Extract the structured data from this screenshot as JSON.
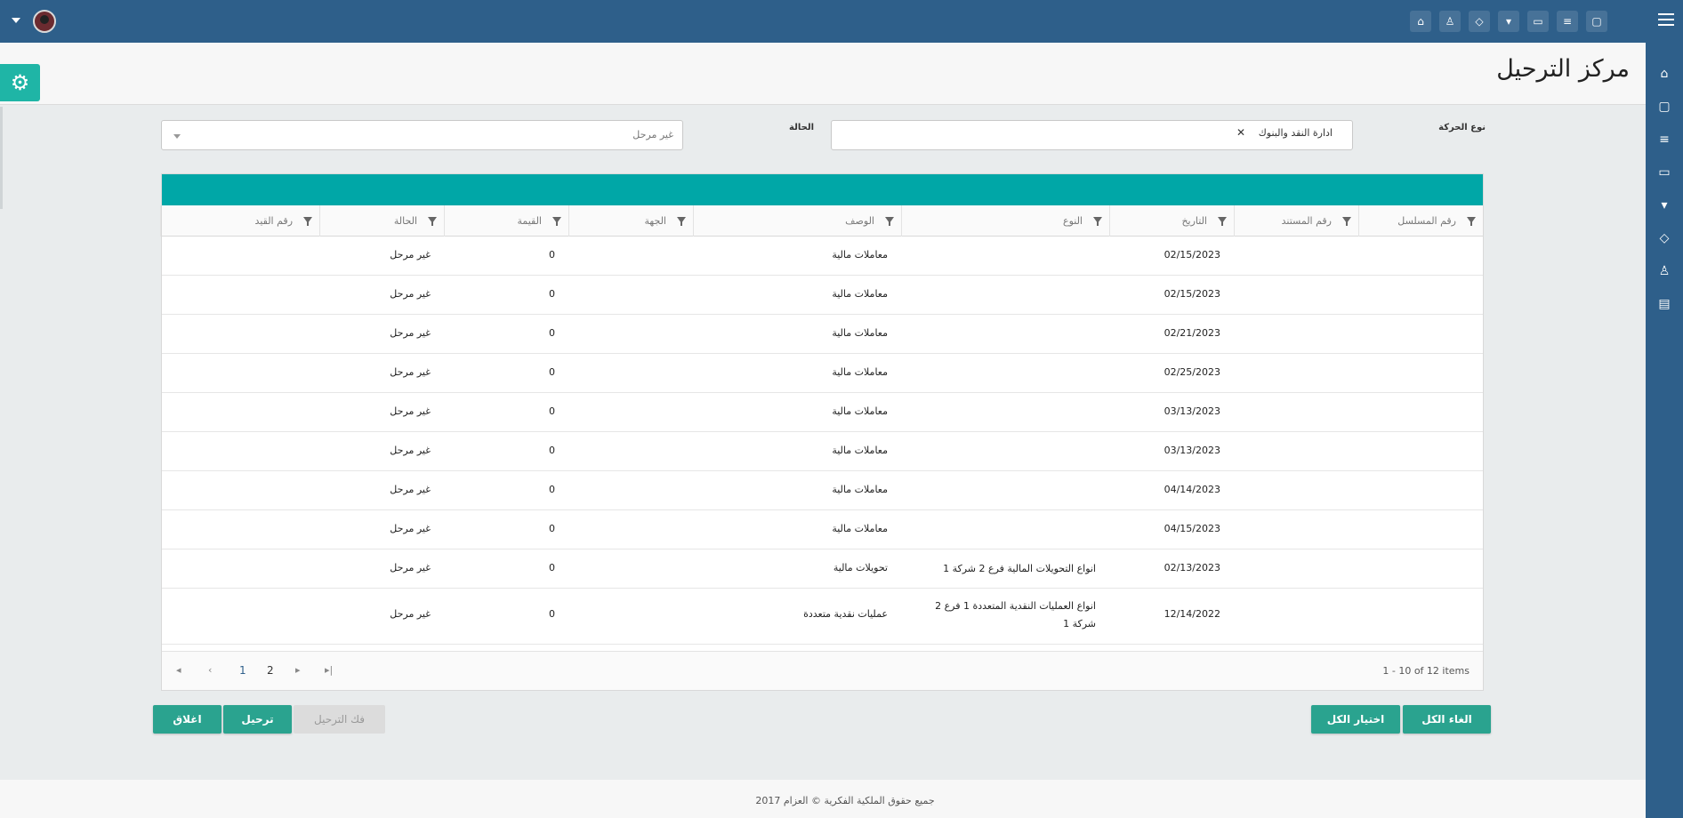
{
  "topbar": {
    "icons": [
      "store-icon",
      "user-icon",
      "tag-icon",
      "cart-icon",
      "inbox-icon",
      "database-icon",
      "monitor-icon"
    ]
  },
  "sidebar": {
    "icons": [
      "home-icon",
      "monitor-icon",
      "database-icon",
      "inbox-icon",
      "cart-icon",
      "tag-icon",
      "user-icon",
      "store-icon"
    ]
  },
  "page": {
    "title": "مركز الترحيل"
  },
  "filters": {
    "movement_type_label": "نوع الحركة",
    "movement_type_tag": "ادارة النقد والبنوك",
    "status_label": "الحالة",
    "status_value": "غير مرحل"
  },
  "grid": {
    "columns": [
      "رقم المسلسل",
      "رقم المستند",
      "التاريخ",
      "النوع",
      "الوصف",
      "الجهة",
      "القيمة",
      "الحالة",
      "رقم القيد"
    ],
    "rows": [
      {
        "serial": "",
        "doc": "",
        "date": "02/15/2023",
        "type": "",
        "desc": "معاملات مالية",
        "party": "",
        "value": "0",
        "status": "غير مرحل",
        "entry": ""
      },
      {
        "serial": "",
        "doc": "",
        "date": "02/15/2023",
        "type": "",
        "desc": "معاملات مالية",
        "party": "",
        "value": "0",
        "status": "غير مرحل",
        "entry": ""
      },
      {
        "serial": "",
        "doc": "",
        "date": "02/21/2023",
        "type": "",
        "desc": "معاملات مالية",
        "party": "",
        "value": "0",
        "status": "غير مرحل",
        "entry": ""
      },
      {
        "serial": "",
        "doc": "",
        "date": "02/25/2023",
        "type": "",
        "desc": "معاملات مالية",
        "party": "",
        "value": "0",
        "status": "غير مرحل",
        "entry": ""
      },
      {
        "serial": "",
        "doc": "",
        "date": "03/13/2023",
        "type": "",
        "desc": "معاملات مالية",
        "party": "",
        "value": "0",
        "status": "غير مرحل",
        "entry": ""
      },
      {
        "serial": "",
        "doc": "",
        "date": "03/13/2023",
        "type": "",
        "desc": "معاملات مالية",
        "party": "",
        "value": "0",
        "status": "غير مرحل",
        "entry": ""
      },
      {
        "serial": "",
        "doc": "",
        "date": "04/14/2023",
        "type": "",
        "desc": "معاملات مالية",
        "party": "",
        "value": "0",
        "status": "غير مرحل",
        "entry": ""
      },
      {
        "serial": "",
        "doc": "",
        "date": "04/15/2023",
        "type": "",
        "desc": "معاملات مالية",
        "party": "",
        "value": "0",
        "status": "غير مرحل",
        "entry": ""
      },
      {
        "serial": "",
        "doc": "",
        "date": "02/13/2023",
        "type": "انواع التحويلات المالية فرع 2 شركة 1",
        "desc": "تحويلات مالية",
        "party": "",
        "value": "0",
        "status": "غير مرحل",
        "entry": ""
      },
      {
        "serial": "",
        "doc": "",
        "date": "12/14/2022",
        "type": "انواع العمليات النقدية المتعددة 1 فرع 2 شركة 1",
        "desc": "عمليات نقدية متعددة",
        "party": "",
        "value": "0",
        "status": "غير مرحل",
        "entry": ""
      }
    ],
    "pager": {
      "pages": [
        "1",
        "2"
      ],
      "active_page": "1",
      "info": "1 - 10 of 12 items"
    }
  },
  "actions": {
    "cancel_all": "الغاء الكل",
    "select_all": "اختيار الكل",
    "unpost": "فك الترحيل",
    "post": "ترحيل",
    "close": "اغلاق"
  },
  "footer": {
    "copyright": "جميع حقوق الملكية الفكرية © العزام 2017"
  },
  "colors": {
    "primary": "#2e5f8a",
    "teal": "#00a7a7",
    "button": "#2aa38f"
  }
}
